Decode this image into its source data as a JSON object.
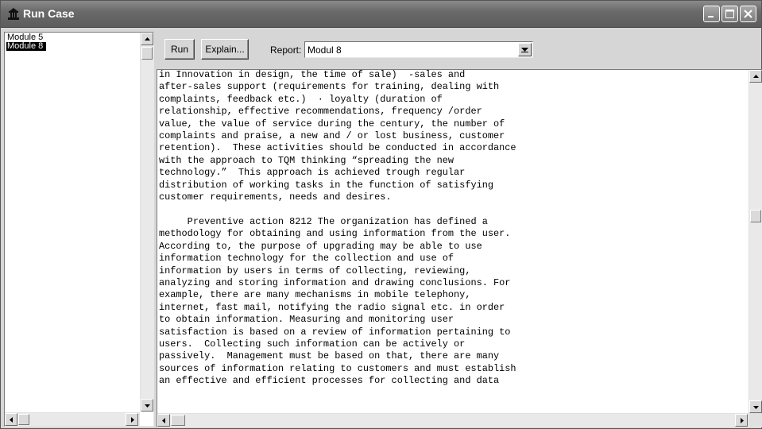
{
  "window": {
    "title": "Run Case"
  },
  "icons": {
    "app": "app-icon",
    "minimize": "minimize-icon",
    "maximize": "maximize-icon",
    "close": "close-icon",
    "scroll_up": "scroll-up-arrow-icon",
    "scroll_down": "scroll-down-arrow-icon",
    "scroll_left": "scroll-left-arrow-icon",
    "scroll_right": "scroll-right-arrow-icon",
    "dropdown": "dropdown-arrow-icon"
  },
  "sidebar": {
    "items": [
      {
        "label": "Module 5",
        "selected": false
      },
      {
        "label": "Module 8",
        "selected": true
      }
    ]
  },
  "toolbar": {
    "run_label": "Run",
    "explain_label": "Explain...",
    "report_label": "Report:",
    "report_value": "Modul 8"
  },
  "content": {
    "text": "in Innovation in design, the time of sale)  -sales and\nafter-sales support (requirements for training, dealing with\ncomplaints, feedback etc.)  · loyalty (duration of\nrelationship, effective recommendations, frequency /order\nvalue, the value of service during the century, the number of\ncomplaints and praise, a new and / or lost business, customer\nretention).  These activities should be conducted in accordance\nwith the approach to TQM thinking “spreading the new\ntechnology.”  This approach is achieved trough regular\ndistribution of working tasks in the function of satisfying\ncustomer requirements, needs and desires.\n\n     Preventive action 8212 The organization has defined a\nmethodology for obtaining and using information from the user.\nAccording to, the purpose of upgrading may be able to use\ninformation technology for the collection and use of\ninformation by users in terms of collecting, reviewing,\nanalyzing and storing information and drawing conclusions. For\nexample, there are many mechanisms in mobile telephony,\ninternet, fast mail, notifying the radio signal etc. in order\nto obtain information. Measuring and monitoring user\nsatisfaction is based on a review of information pertaining to\nusers.  Collecting such information can be actively or\npassively.  Management must be based on that, there are many\nsources of information relating to customers and must establish\nan effective and efficient processes for collecting and data"
  }
}
